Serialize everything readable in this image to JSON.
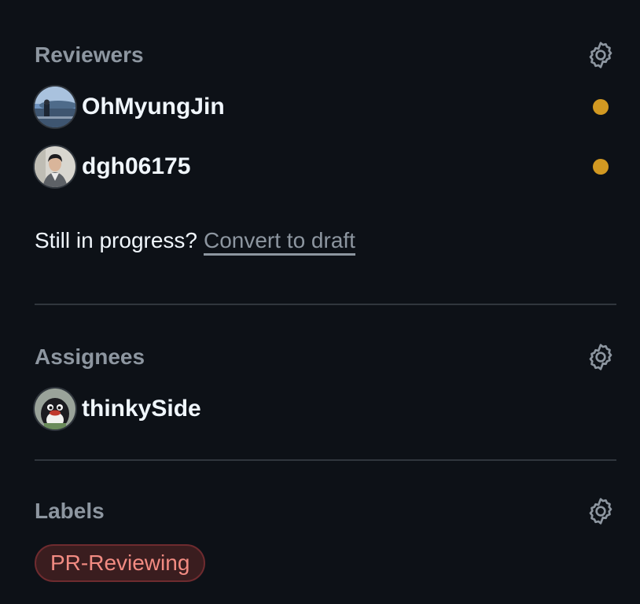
{
  "reviewers": {
    "title": "Reviewers",
    "items": [
      {
        "name": "OhMyungJin",
        "status": "pending",
        "status_color": "#d29922"
      },
      {
        "name": "dgh06175",
        "status": "pending",
        "status_color": "#d29922"
      }
    ],
    "draft_prompt": "Still in progress?",
    "draft_link": "Convert to draft"
  },
  "assignees": {
    "title": "Assignees",
    "items": [
      {
        "name": "thinkySide"
      }
    ]
  },
  "labels": {
    "title": "Labels",
    "items": [
      {
        "name": "PR-Reviewing",
        "color": "#f28b82"
      }
    ]
  },
  "theme": {
    "background": "#0d1117",
    "muted_text": "#8d96a0",
    "divider": "#30363d"
  }
}
